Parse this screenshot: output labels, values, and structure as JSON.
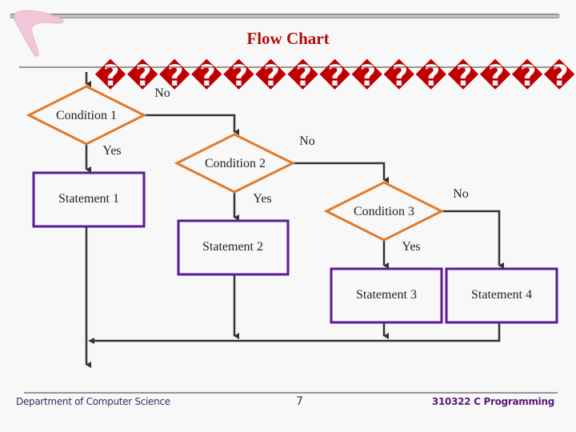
{
  "slide": {
    "title": "Flow Chart",
    "subtitle_glyphs": "����������������",
    "footer": {
      "department": "Department of Computer Science",
      "page_number": "7",
      "course": "310322 C Programming"
    }
  },
  "colors": {
    "background": "#f8f8f8",
    "title": "#b30c0c",
    "decision_stroke": "#e07a2a",
    "process_stroke": "#5a1a9a",
    "connector": "#333333",
    "glyphs": "#c00000"
  },
  "flowchart": {
    "decisions": [
      {
        "id": "c1",
        "label": "Condition 1"
      },
      {
        "id": "c2",
        "label": "Condition 2"
      },
      {
        "id": "c3",
        "label": "Condition 3"
      }
    ],
    "processes": [
      {
        "id": "s1",
        "label": "Statement 1"
      },
      {
        "id": "s2",
        "label": "Statement 2"
      },
      {
        "id": "s3",
        "label": "Statement 3"
      },
      {
        "id": "s4",
        "label": "Statement 4"
      }
    ],
    "edges": [
      {
        "from": "c1",
        "to": "s1",
        "label": "Yes"
      },
      {
        "from": "c1",
        "to": "c2",
        "label": "No"
      },
      {
        "from": "c2",
        "to": "s2",
        "label": "Yes"
      },
      {
        "from": "c2",
        "to": "c3",
        "label": "No"
      },
      {
        "from": "c3",
        "to": "s3",
        "label": "Yes"
      },
      {
        "from": "c3",
        "to": "s4",
        "label": "No"
      }
    ]
  }
}
